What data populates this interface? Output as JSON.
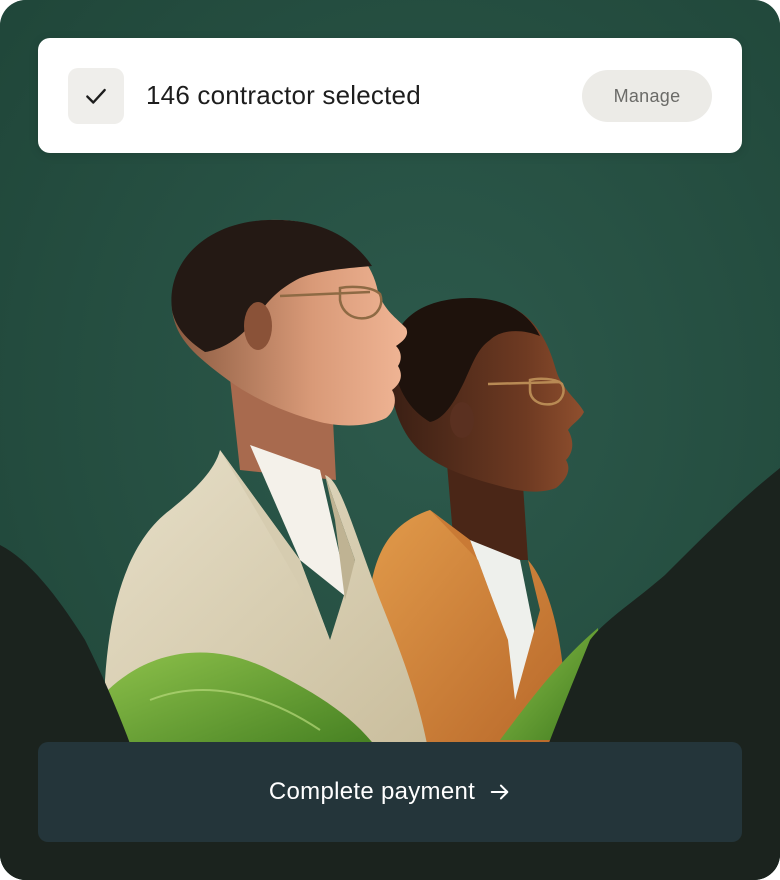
{
  "selection": {
    "text": "146 contractor selected",
    "icon": "check-icon"
  },
  "actions": {
    "manage_label": "Manage",
    "complete_payment_label": "Complete payment",
    "complete_payment_icon": "arrow-right-icon"
  },
  "colors": {
    "background_green": "#264e43",
    "foliage_dark": "#1b231e",
    "leaf_green": "#5f9a2c",
    "pay_button": "#24353a",
    "manage_button": "#ecebe7",
    "check_box": "#efeeeb"
  },
  "photo": {
    "subject": "two-men-profile-portrait",
    "icon": "photo"
  }
}
